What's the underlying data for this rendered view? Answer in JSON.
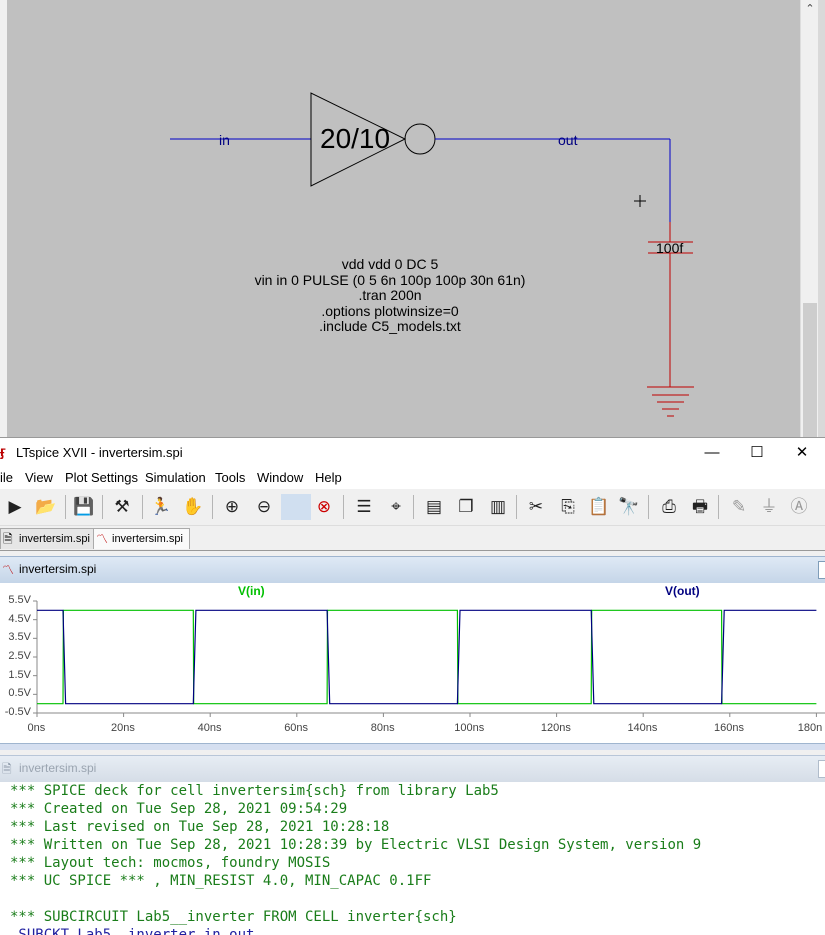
{
  "schematic": {
    "inverter_label": "20/10",
    "net_in": "in",
    "net_out": "out",
    "cap_value": "100f",
    "spice_lines": [
      "vdd vdd 0 DC 5",
      "vin in 0 PULSE (0 5 6n 100p 100p 30n 61n)",
      ".tran 200n",
      ".options plotwinsize=0",
      ".include C5_models.txt"
    ]
  },
  "window": {
    "title": "LTspice XVII - invertersim.spi",
    "minimize": "—",
    "maximize": "☐",
    "close": "✕"
  },
  "menu": [
    "ile",
    "View",
    "Plot Settings",
    "Simulation",
    "Tools",
    "Window",
    "Help"
  ],
  "toolbar_icons": [
    "run-icon",
    "open-icon",
    "save-icon",
    "hammer-icon",
    "running-man-icon",
    "hand-icon",
    "zoom-in-icon",
    "zoom-out-icon",
    "zoom-box-icon",
    "zoom-cancel-icon",
    "autorange-icon",
    "marker-icon",
    "tile-horizontal-icon",
    "cascade-icon",
    "tile-vertical-icon",
    "cut-icon",
    "copy-icon",
    "paste-icon",
    "find-icon",
    "print-preview-icon",
    "print-icon",
    "pencil-icon",
    "ground-icon",
    "label-icon"
  ],
  "tabs": [
    {
      "label": "invertersim.spi"
    },
    {
      "label": "invertersim.spi"
    }
  ],
  "plot_pane": {
    "title": "invertersim.spi"
  },
  "netlist_pane": {
    "title": "invertersim.spi",
    "lines": [
      "*** SPICE deck for cell invertersim{sch} from library Lab5",
      "*** Created on Tue Sep 28, 2021 09:54:29",
      "*** Last revised on Tue Sep 28, 2021 10:28:18",
      "*** Written on Tue Sep 28, 2021 10:28:39 by Electric VLSI Design System, version 9",
      "*** Layout tech: mocmos, foundry MOSIS",
      "*** UC SPICE *** , MIN_RESIST 4.0, MIN_CAPAC 0.1FF",
      "",
      "*** SUBCIRCUIT Lab5__inverter FROM CELL inverter{sch}",
      ".SUBCKT Lab5__inverter in out"
    ]
  },
  "chart_data": {
    "type": "line",
    "title": "",
    "xlabel": "",
    "ylabel": "",
    "xlim": [
      0,
      180
    ],
    "ylim": [
      -0.5,
      5.5
    ],
    "x_ticks": [
      "0ns",
      "20ns",
      "40ns",
      "60ns",
      "80ns",
      "100ns",
      "120ns",
      "140ns",
      "160ns",
      "180n"
    ],
    "y_ticks": [
      "5.5V",
      "4.5V",
      "3.5V",
      "2.5V",
      "1.5V",
      "0.5V",
      "-0.5V"
    ],
    "series": [
      {
        "name": "V(in)",
        "color": "#00c000",
        "x": [
          0,
          6,
          6.1,
          36.1,
          36.2,
          67,
          67.1,
          97.1,
          97.2,
          128,
          128.1,
          158.1,
          158.2,
          180
        ],
        "y": [
          0,
          0,
          5,
          5,
          0,
          0,
          5,
          5,
          0,
          0,
          5,
          5,
          0,
          0
        ]
      },
      {
        "name": "V(out)",
        "color": "#000080",
        "x": [
          0,
          6,
          6.6,
          36.1,
          36.7,
          67,
          67.6,
          97.1,
          97.7,
          128,
          128.6,
          158.1,
          158.7,
          180
        ],
        "y": [
          5,
          5,
          0,
          0,
          5,
          5,
          0,
          0,
          5,
          5,
          0,
          0,
          5,
          5
        ]
      }
    ]
  }
}
